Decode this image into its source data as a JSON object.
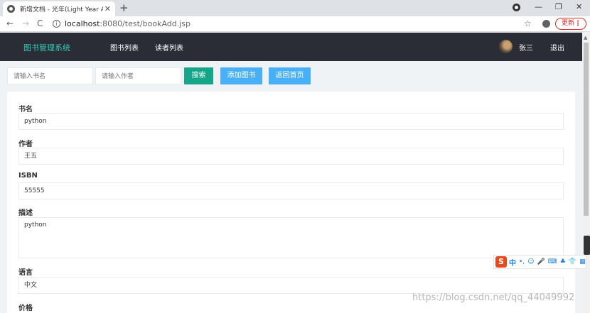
{
  "browser": {
    "tab_title": "新增文档 - 光年(Light Year Admin",
    "tab_close": "✕",
    "new_tab": "+",
    "url_host": "localhost",
    "url_path": ":8080/test/bookAdd.jsp",
    "update_label": "更新",
    "window_controls": [
      "—",
      "❐",
      "✕"
    ],
    "nav_icons": [
      "←",
      "→",
      "C"
    ]
  },
  "navbar": {
    "brand": "图书管理系统",
    "links": [
      "图书列表",
      "读者列表"
    ],
    "user_name": "张三",
    "logout": "退出"
  },
  "search": {
    "book_placeholder": "请输入书名",
    "author_placeholder": "请输入作者",
    "search_label": "搜索",
    "add_label": "添加图书",
    "home_label": "返回首页"
  },
  "form": {
    "fields": [
      {
        "label": "书名",
        "value": "python"
      },
      {
        "label": "作者",
        "value": "王五"
      },
      {
        "label": "ISBN",
        "value": "55555"
      },
      {
        "label": "描述",
        "value": "python"
      },
      {
        "label": "语言",
        "value": "中文"
      },
      {
        "label": "价格",
        "value": ""
      }
    ]
  },
  "ime": {
    "logo": "S",
    "mode": "中",
    "items": [
      "•,",
      "☺",
      "🎤",
      "⌨",
      "♣",
      "👕",
      "▦"
    ]
  },
  "watermark": "https://blog.csdn.net/qq_44049992",
  "colors": {
    "navbar_bg": "#2a2d35",
    "brand": "#33cabb",
    "search_btn": "#15a589",
    "action_btn": "#48b0f7",
    "update_btn": "#d93025"
  }
}
